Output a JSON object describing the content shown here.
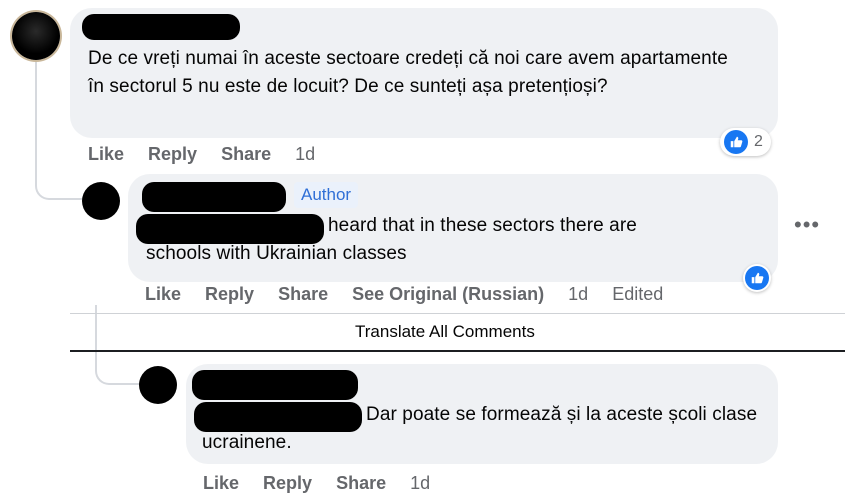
{
  "comment1": {
    "text": "De ce vreți numai în aceste sectoare credeți că noi care avem apartamente în sectorul 5 nu este de locuit? De ce sunteți așa pretențioși?",
    "actions": {
      "like": "Like",
      "reply": "Reply",
      "share": "Share"
    },
    "time": "1d",
    "reaction_count": "2"
  },
  "reply1": {
    "badge": "Author",
    "text": "heard that in these sectors there are schools with Ukrainian classes",
    "actions": {
      "like": "Like",
      "reply": "Reply",
      "share": "Share",
      "see_original": "See Original (Russian)"
    },
    "time": "1d",
    "edited": "Edited"
  },
  "translate_all": "Translate All Comments",
  "reply2": {
    "text": "Dar poate se formează și la aceste școli clase ucrainene.",
    "actions": {
      "like": "Like",
      "reply": "Reply",
      "share": "Share"
    },
    "time": "1d"
  },
  "colors": {
    "bubble": "#eff1f4",
    "accent": "#1877f2",
    "meta": "#65676b"
  },
  "icons": [
    "like-icon",
    "more-options-icon"
  ]
}
